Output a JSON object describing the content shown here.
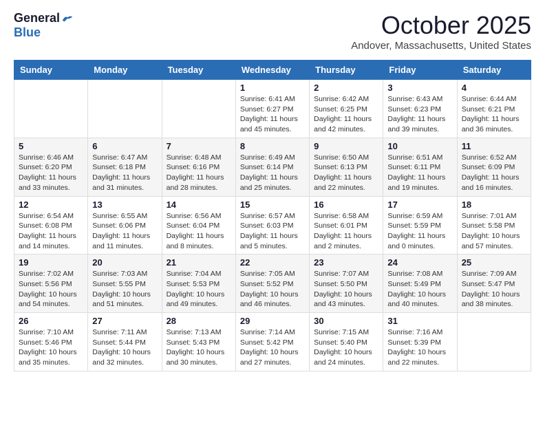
{
  "logo": {
    "general": "General",
    "blue": "Blue"
  },
  "title": "October 2025",
  "location": "Andover, Massachusetts, United States",
  "headers": [
    "Sunday",
    "Monday",
    "Tuesday",
    "Wednesday",
    "Thursday",
    "Friday",
    "Saturday"
  ],
  "weeks": [
    [
      {
        "day": "",
        "info": ""
      },
      {
        "day": "",
        "info": ""
      },
      {
        "day": "",
        "info": ""
      },
      {
        "day": "1",
        "info": "Sunrise: 6:41 AM\nSunset: 6:27 PM\nDaylight: 11 hours\nand 45 minutes."
      },
      {
        "day": "2",
        "info": "Sunrise: 6:42 AM\nSunset: 6:25 PM\nDaylight: 11 hours\nand 42 minutes."
      },
      {
        "day": "3",
        "info": "Sunrise: 6:43 AM\nSunset: 6:23 PM\nDaylight: 11 hours\nand 39 minutes."
      },
      {
        "day": "4",
        "info": "Sunrise: 6:44 AM\nSunset: 6:21 PM\nDaylight: 11 hours\nand 36 minutes."
      }
    ],
    [
      {
        "day": "5",
        "info": "Sunrise: 6:46 AM\nSunset: 6:20 PM\nDaylight: 11 hours\nand 33 minutes."
      },
      {
        "day": "6",
        "info": "Sunrise: 6:47 AM\nSunset: 6:18 PM\nDaylight: 11 hours\nand 31 minutes."
      },
      {
        "day": "7",
        "info": "Sunrise: 6:48 AM\nSunset: 6:16 PM\nDaylight: 11 hours\nand 28 minutes."
      },
      {
        "day": "8",
        "info": "Sunrise: 6:49 AM\nSunset: 6:14 PM\nDaylight: 11 hours\nand 25 minutes."
      },
      {
        "day": "9",
        "info": "Sunrise: 6:50 AM\nSunset: 6:13 PM\nDaylight: 11 hours\nand 22 minutes."
      },
      {
        "day": "10",
        "info": "Sunrise: 6:51 AM\nSunset: 6:11 PM\nDaylight: 11 hours\nand 19 minutes."
      },
      {
        "day": "11",
        "info": "Sunrise: 6:52 AM\nSunset: 6:09 PM\nDaylight: 11 hours\nand 16 minutes."
      }
    ],
    [
      {
        "day": "12",
        "info": "Sunrise: 6:54 AM\nSunset: 6:08 PM\nDaylight: 11 hours\nand 14 minutes."
      },
      {
        "day": "13",
        "info": "Sunrise: 6:55 AM\nSunset: 6:06 PM\nDaylight: 11 hours\nand 11 minutes."
      },
      {
        "day": "14",
        "info": "Sunrise: 6:56 AM\nSunset: 6:04 PM\nDaylight: 11 hours\nand 8 minutes."
      },
      {
        "day": "15",
        "info": "Sunrise: 6:57 AM\nSunset: 6:03 PM\nDaylight: 11 hours\nand 5 minutes."
      },
      {
        "day": "16",
        "info": "Sunrise: 6:58 AM\nSunset: 6:01 PM\nDaylight: 11 hours\nand 2 minutes."
      },
      {
        "day": "17",
        "info": "Sunrise: 6:59 AM\nSunset: 5:59 PM\nDaylight: 11 hours\nand 0 minutes."
      },
      {
        "day": "18",
        "info": "Sunrise: 7:01 AM\nSunset: 5:58 PM\nDaylight: 10 hours\nand 57 minutes."
      }
    ],
    [
      {
        "day": "19",
        "info": "Sunrise: 7:02 AM\nSunset: 5:56 PM\nDaylight: 10 hours\nand 54 minutes."
      },
      {
        "day": "20",
        "info": "Sunrise: 7:03 AM\nSunset: 5:55 PM\nDaylight: 10 hours\nand 51 minutes."
      },
      {
        "day": "21",
        "info": "Sunrise: 7:04 AM\nSunset: 5:53 PM\nDaylight: 10 hours\nand 49 minutes."
      },
      {
        "day": "22",
        "info": "Sunrise: 7:05 AM\nSunset: 5:52 PM\nDaylight: 10 hours\nand 46 minutes."
      },
      {
        "day": "23",
        "info": "Sunrise: 7:07 AM\nSunset: 5:50 PM\nDaylight: 10 hours\nand 43 minutes."
      },
      {
        "day": "24",
        "info": "Sunrise: 7:08 AM\nSunset: 5:49 PM\nDaylight: 10 hours\nand 40 minutes."
      },
      {
        "day": "25",
        "info": "Sunrise: 7:09 AM\nSunset: 5:47 PM\nDaylight: 10 hours\nand 38 minutes."
      }
    ],
    [
      {
        "day": "26",
        "info": "Sunrise: 7:10 AM\nSunset: 5:46 PM\nDaylight: 10 hours\nand 35 minutes."
      },
      {
        "day": "27",
        "info": "Sunrise: 7:11 AM\nSunset: 5:44 PM\nDaylight: 10 hours\nand 32 minutes."
      },
      {
        "day": "28",
        "info": "Sunrise: 7:13 AM\nSunset: 5:43 PM\nDaylight: 10 hours\nand 30 minutes."
      },
      {
        "day": "29",
        "info": "Sunrise: 7:14 AM\nSunset: 5:42 PM\nDaylight: 10 hours\nand 27 minutes."
      },
      {
        "day": "30",
        "info": "Sunrise: 7:15 AM\nSunset: 5:40 PM\nDaylight: 10 hours\nand 24 minutes."
      },
      {
        "day": "31",
        "info": "Sunrise: 7:16 AM\nSunset: 5:39 PM\nDaylight: 10 hours\nand 22 minutes."
      },
      {
        "day": "",
        "info": ""
      }
    ]
  ]
}
